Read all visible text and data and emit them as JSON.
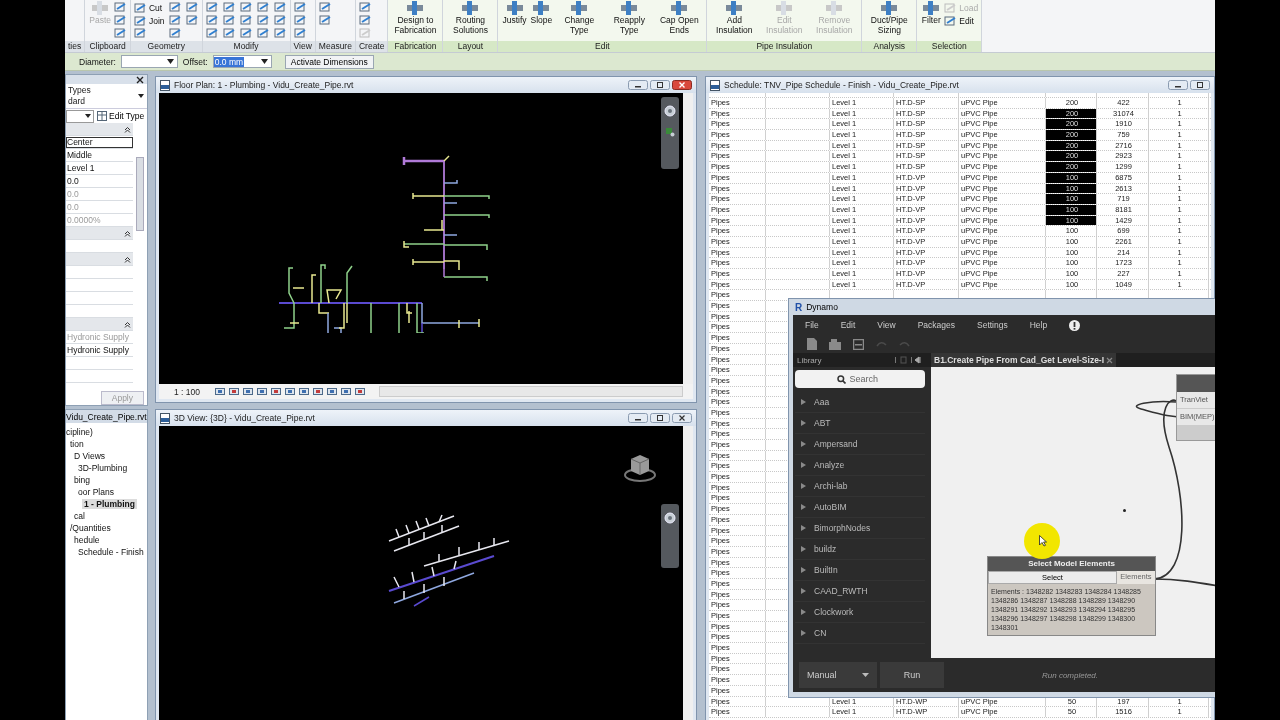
{
  "ribbon": {
    "panels": [
      {
        "label": "ties",
        "contextual": false
      },
      {
        "label": "Clipboard",
        "contextual": false,
        "buttons": [
          {
            "kind": "large",
            "label": "Paste",
            "disabled": true
          },
          {
            "kind": "icon",
            "disabled": false
          },
          {
            "kind": "icon",
            "disabled": false
          },
          {
            "kind": "icon",
            "disabled": false
          }
        ]
      },
      {
        "label": "Geometry",
        "contextual": false,
        "buttons": [
          {
            "kind": "small",
            "label": "Cut",
            "disabled": false
          },
          {
            "kind": "small",
            "label": "Join",
            "disabled": false
          },
          {
            "kind": "icon",
            "disabled": false
          },
          {
            "kind": "icon",
            "disabled": false
          },
          {
            "kind": "icon",
            "disabled": false
          },
          {
            "kind": "icon",
            "disabled": false
          },
          {
            "kind": "icon",
            "disabled": false
          },
          {
            "kind": "icon",
            "disabled": false
          }
        ]
      },
      {
        "label": "Modify",
        "contextual": false,
        "buttons": [
          {
            "kind": "icon",
            "disabled": false
          },
          {
            "kind": "icon",
            "disabled": false
          },
          {
            "kind": "icon",
            "disabled": false
          },
          {
            "kind": "icon",
            "disabled": false
          },
          {
            "kind": "icon",
            "disabled": false
          },
          {
            "kind": "icon",
            "disabled": false
          },
          {
            "kind": "icon",
            "disabled": false
          },
          {
            "kind": "icon",
            "disabled": false
          },
          {
            "kind": "icon",
            "disabled": false
          },
          {
            "kind": "icon",
            "disabled": false
          },
          {
            "kind": "icon",
            "disabled": false
          },
          {
            "kind": "icon",
            "disabled": false
          },
          {
            "kind": "icon",
            "disabled": false
          },
          {
            "kind": "icon",
            "disabled": false
          },
          {
            "kind": "icon",
            "disabled": false
          }
        ]
      },
      {
        "label": "View",
        "contextual": false,
        "buttons": [
          {
            "kind": "icon",
            "disabled": false
          },
          {
            "kind": "icon",
            "disabled": false
          },
          {
            "kind": "icon",
            "disabled": false
          }
        ]
      },
      {
        "label": "Measure",
        "contextual": false,
        "buttons": [
          {
            "kind": "icon",
            "disabled": false
          },
          {
            "kind": "icon",
            "disabled": false
          }
        ]
      },
      {
        "label": "Create",
        "contextual": false,
        "buttons": [
          {
            "kind": "icon",
            "disabled": false
          },
          {
            "kind": "icon",
            "disabled": false
          },
          {
            "kind": "icon",
            "disabled": true
          }
        ]
      },
      {
        "label": "Fabrication",
        "contextual": true,
        "buttons": [
          {
            "kind": "large",
            "label": "Design to Fabrication",
            "disabled": false
          }
        ]
      },
      {
        "label": "Layout",
        "contextual": true,
        "buttons": [
          {
            "kind": "large",
            "label": "Routing Solutions",
            "disabled": false
          }
        ]
      },
      {
        "label": "Edit",
        "contextual": true,
        "buttons": [
          {
            "kind": "large",
            "label": "Justify",
            "disabled": false
          },
          {
            "kind": "large",
            "label": "Slope",
            "disabled": false
          },
          {
            "kind": "large",
            "label": "Change Type",
            "disabled": false
          },
          {
            "kind": "large",
            "label": "Reapply Type",
            "disabled": false
          },
          {
            "kind": "large",
            "label": "Cap Open Ends",
            "disabled": false
          }
        ]
      },
      {
        "label": "Pipe Insulation",
        "contextual": true,
        "buttons": [
          {
            "kind": "large",
            "label": "Add Insulation",
            "disabled": false
          },
          {
            "kind": "large",
            "label": "Edit Insulation",
            "disabled": true
          },
          {
            "kind": "large",
            "label": "Remove Insulation",
            "disabled": true
          }
        ]
      },
      {
        "label": "Analysis",
        "contextual": true,
        "buttons": [
          {
            "kind": "large",
            "label": "Duct/Pipe Sizing",
            "disabled": false
          }
        ]
      },
      {
        "label": "Selection",
        "contextual": true,
        "buttons": [
          {
            "kind": "large",
            "label": "Filter",
            "disabled": false
          },
          {
            "kind": "small",
            "label": "Load",
            "disabled": true
          },
          {
            "kind": "small",
            "label": "Edit",
            "disabled": false
          }
        ]
      }
    ]
  },
  "options_bar": {
    "diameter_label": "Diameter:",
    "offset_label": "Offset:",
    "offset_value": "0.0 mm",
    "button": "Activate Dimensions"
  },
  "properties": {
    "type_lines": [
      "Types",
      "dard"
    ],
    "edit_type": "Edit Type",
    "rows": [
      {
        "kind": "value",
        "value": "Center",
        "disabled": false,
        "selected": true
      },
      {
        "kind": "value",
        "value": "Middle",
        "disabled": false,
        "selected": false
      },
      {
        "kind": "value",
        "value": "Level 1",
        "disabled": false,
        "selected": false
      },
      {
        "kind": "value",
        "value": "0.0",
        "disabled": false,
        "selected": false
      },
      {
        "kind": "value",
        "value": "0.0",
        "disabled": true,
        "selected": false
      },
      {
        "kind": "value",
        "value": "0.0",
        "disabled": true,
        "selected": false
      },
      {
        "kind": "value",
        "value": "0.0000%",
        "disabled": true,
        "selected": false
      },
      {
        "kind": "group"
      },
      {
        "kind": "blank"
      },
      {
        "kind": "group"
      },
      {
        "kind": "blank"
      },
      {
        "kind": "blank"
      },
      {
        "kind": "blank"
      },
      {
        "kind": "blank"
      },
      {
        "kind": "group"
      },
      {
        "kind": "value",
        "value": "Hydronic Supply",
        "disabled": true,
        "selected": false
      },
      {
        "kind": "value",
        "value": "Hydronic Supply",
        "disabled": false,
        "selected": false
      },
      {
        "kind": "blank"
      },
      {
        "kind": "blank"
      }
    ],
    "apply": "Apply"
  },
  "project_browser": {
    "title": "Vidu_Create_Pipe.rvt",
    "tree": [
      {
        "label": "cipline)",
        "selected": false,
        "children": [
          {
            "label": "tion",
            "selected": false,
            "children": [
              {
                "label": "D Views",
                "selected": false,
                "children": [
                  {
                    "label": "3D-Plumbing",
                    "selected": false
                  }
                ]
              },
              {
                "label": "bing",
                "selected": false,
                "children": [
                  {
                    "label": "oor Plans",
                    "selected": false,
                    "children": [
                      {
                        "label": "1 - Plumbing",
                        "selected": true
                      }
                    ]
                  }
                ]
              },
              {
                "label": "cal",
                "selected": false
              }
            ]
          },
          {
            "label": "/Quantities",
            "selected": false,
            "children": [
              {
                "label": "hedule",
                "selected": false,
                "children": [
                  {
                    "label": "Schedule - Finish",
                    "selected": false
                  }
                ]
              }
            ]
          }
        ]
      }
    ]
  },
  "floor_plan": {
    "title": "Floor Plan: 1 - Plumbing - Vidu_Create_Pipe.rvt",
    "scale": "1 : 100"
  },
  "view_3d": {
    "title": "3D View: {3D} - Vidu_Create_Pipe.rvt"
  },
  "schedule": {
    "title": "Schedule: TNV_Pipe Schedule - Finish - Vidu_Create_Pipe.rvt",
    "rows": [
      {
        "column_1": "Pipes",
        "column_3": "Level 1",
        "column_4": "HT.D-SP",
        "column_5": "uPVC Pipe",
        "column_6": "200",
        "column_7": "422",
        "column_8": "1",
        "selected": false
      },
      {
        "column_1": "Pipes",
        "column_3": "Level 1",
        "column_4": "HT.D-SP",
        "column_5": "uPVC Pipe",
        "column_6": "200",
        "column_7": "31074",
        "column_8": "1",
        "selected": true
      },
      {
        "column_1": "Pipes",
        "column_3": "Level 1",
        "column_4": "HT.D-SP",
        "column_5": "uPVC Pipe",
        "column_6": "200",
        "column_7": "1910",
        "column_8": "1",
        "selected": true
      },
      {
        "column_1": "Pipes",
        "column_3": "Level 1",
        "column_4": "HT.D-SP",
        "column_5": "uPVC Pipe",
        "column_6": "200",
        "column_7": "759",
        "column_8": "1",
        "selected": true
      },
      {
        "column_1": "Pipes",
        "column_3": "Level 1",
        "column_4": "HT.D-SP",
        "column_5": "uPVC Pipe",
        "column_6": "200",
        "column_7": "2716",
        "column_8": "1",
        "selected": true
      },
      {
        "column_1": "Pipes",
        "column_3": "Level 1",
        "column_4": "HT.D-SP",
        "column_5": "uPVC Pipe",
        "column_6": "200",
        "column_7": "2923",
        "column_8": "1",
        "selected": true
      },
      {
        "column_1": "Pipes",
        "column_3": "Level 1",
        "column_4": "HT.D-SP",
        "column_5": "uPVC Pipe",
        "column_6": "200",
        "column_7": "1299",
        "column_8": "1",
        "selected": true
      },
      {
        "column_1": "Pipes",
        "column_3": "Level 1",
        "column_4": "HT.D-VP",
        "column_5": "uPVC Pipe",
        "column_6": "100",
        "column_7": "6875",
        "column_8": "1",
        "selected": true
      },
      {
        "column_1": "Pipes",
        "column_3": "Level 1",
        "column_4": "HT.D-VP",
        "column_5": "uPVC Pipe",
        "column_6": "100",
        "column_7": "2613",
        "column_8": "1",
        "selected": true
      },
      {
        "column_1": "Pipes",
        "column_3": "Level 1",
        "column_4": "HT.D-VP",
        "column_5": "uPVC Pipe",
        "column_6": "100",
        "column_7": "719",
        "column_8": "1",
        "selected": true
      },
      {
        "column_1": "Pipes",
        "column_3": "Level 1",
        "column_4": "HT.D-VP",
        "column_5": "uPVC Pipe",
        "column_6": "100",
        "column_7": "8181",
        "column_8": "1",
        "selected": true
      },
      {
        "column_1": "Pipes",
        "column_3": "Level 1",
        "column_4": "HT.D-VP",
        "column_5": "uPVC Pipe",
        "column_6": "100",
        "column_7": "1429",
        "column_8": "1",
        "selected": true
      },
      {
        "column_1": "Pipes",
        "column_3": "Level 1",
        "column_4": "HT.D-VP",
        "column_5": "uPVC Pipe",
        "column_6": "100",
        "column_7": "699",
        "column_8": "1",
        "selected": false
      },
      {
        "column_1": "Pipes",
        "column_3": "Level 1",
        "column_4": "HT.D-VP",
        "column_5": "uPVC Pipe",
        "column_6": "100",
        "column_7": "2261",
        "column_8": "1",
        "selected": false
      },
      {
        "column_1": "Pipes",
        "column_3": "Level 1",
        "column_4": "HT.D-VP",
        "column_5": "uPVC Pipe",
        "column_6": "100",
        "column_7": "214",
        "column_8": "1",
        "selected": false
      },
      {
        "column_1": "Pipes",
        "column_3": "Level 1",
        "column_4": "HT.D-VP",
        "column_5": "uPVC Pipe",
        "column_6": "100",
        "column_7": "1723",
        "column_8": "1",
        "selected": false
      },
      {
        "column_1": "Pipes",
        "column_3": "Level 1",
        "column_4": "HT.D-VP",
        "column_5": "uPVC Pipe",
        "column_6": "100",
        "column_7": "227",
        "column_8": "1",
        "selected": false
      },
      {
        "column_1": "Pipes",
        "column_3": "Level 1",
        "column_4": "HT.D-VP",
        "column_5": "uPVC Pipe",
        "column_6": "100",
        "column_7": "1049",
        "column_8": "1",
        "selected": false
      },
      {
        "column_1": "Pipes"
      },
      {
        "column_1": "Pipes"
      },
      {
        "column_1": "Pipes"
      },
      {
        "column_1": "Pipes"
      },
      {
        "column_1": "Pipes"
      },
      {
        "column_1": "Pipes"
      },
      {
        "column_1": "Pipes"
      },
      {
        "column_1": "Pipes"
      },
      {
        "column_1": "Pipes"
      },
      {
        "column_1": "Pipes"
      },
      {
        "column_1": "Pipes"
      },
      {
        "column_1": "Pipes"
      },
      {
        "column_1": "Pipes"
      },
      {
        "column_1": "Pipes"
      },
      {
        "column_1": "Pipes"
      },
      {
        "column_1": "Pipes"
      },
      {
        "column_1": "Pipes"
      },
      {
        "column_1": "Pipes"
      },
      {
        "column_1": "Pipes"
      },
      {
        "column_1": "Pipes"
      },
      {
        "column_1": "Pipes"
      },
      {
        "column_1": "Pipes"
      },
      {
        "column_1": "Pipes"
      },
      {
        "column_1": "Pipes"
      },
      {
        "column_1": "Pipes"
      },
      {
        "column_1": "Pipes"
      },
      {
        "column_1": "Pipes"
      },
      {
        "column_1": "Pipes"
      },
      {
        "column_1": "Pipes"
      },
      {
        "column_1": "Pipes"
      },
      {
        "column_1": "Pipes"
      },
      {
        "column_1": "Pipes"
      },
      {
        "column_1": "Pipes"
      },
      {
        "column_1": "Pipes"
      },
      {
        "column_1": "Pipes"
      },
      {
        "column_1": "Pipes"
      },
      {
        "column_1": "Pipes"
      },
      {
        "column_1": "Pipes"
      },
      {
        "column_1": "Pipes",
        "column_3": "Level 1",
        "column_4": "HT.D-WP",
        "column_5": "uPVC Pipe",
        "column_6": "50",
        "column_7": "197",
        "column_8": "1",
        "selected": false
      },
      {
        "column_1": "Pipes",
        "column_3": "Level 1",
        "column_4": "HT.D-WP",
        "column_5": "uPVC Pipe",
        "column_6": "50",
        "column_7": "1516",
        "column_8": "1",
        "selected": false
      }
    ]
  },
  "dynamo": {
    "logo": "R",
    "title": "Dynamo",
    "menu": [
      "File",
      "Edit",
      "View",
      "Packages",
      "Settings",
      "Help"
    ],
    "library_title": "Library",
    "tab": "B1.Create Pipe From Cad_Get Level-Size-I",
    "search_placeholder": "Search",
    "library": [
      "Aaa",
      "ABT",
      "Ampersand",
      "Analyze",
      "Archi-lab",
      "AutoBIM",
      "BimorphNodes",
      "buildz",
      "BuiltIn",
      "CAAD_RWTH",
      "Clockwork",
      "CN"
    ],
    "select_node": {
      "title": "Select Model Elements",
      "button": "Select",
      "output": "Elements",
      "text": "Elements : 1348282 1348283 1348284 1348285 1348286 1348287 1348288 1348289 1348290 1348291 1348292 1348293 1348294 1348295 1348296 1348297 1348298 1348299 1348300 1348301"
    },
    "right_node": {
      "inputs": [
        "TranViet",
        "BIM(MEP)"
      ]
    },
    "run_mode": "Manual",
    "run": "Run",
    "status": "Run completed."
  }
}
